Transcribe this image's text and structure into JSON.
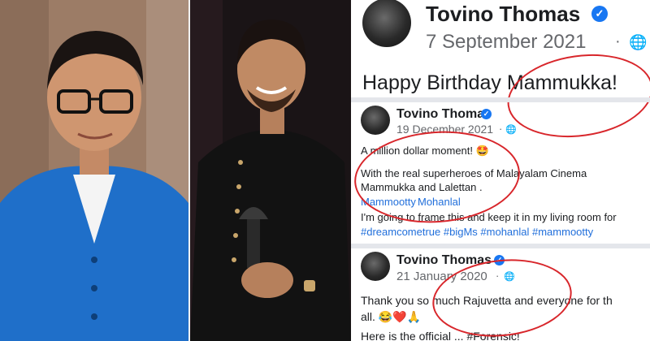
{
  "posts": [
    {
      "author": "Tovino Thomas",
      "date": "7 September 2021",
      "separator": "·",
      "body": "Happy Birthday Mammukka!"
    },
    {
      "author": "Tovino Thomas",
      "date": "19 December 2021",
      "separator": "·",
      "line1": "A million dollar moment! 🤩",
      "line2": "With the real superheroes of Malayalam Cinema",
      "line3": "Mammukka and Lalettan .",
      "tag1": "Mammootty",
      "tag2": "Mohanlal",
      "line4": "I'm going to frame this and keep it in my living room for",
      "hashtags": "#dreamcometrue #bigMs #mohanlal #mammootty"
    },
    {
      "author": "Tovino Thomas",
      "date": "21 January 2020",
      "separator": "·",
      "line1": "Thank you so much Rajuvetta and everyone for th",
      "line2": "all. 😂❤️🙏",
      "line3": "Here is the official ... #Forensic!"
    }
  ],
  "highlight_color": "#d8262b",
  "link_color": "#216fdb",
  "verified_color": "#1877f2"
}
